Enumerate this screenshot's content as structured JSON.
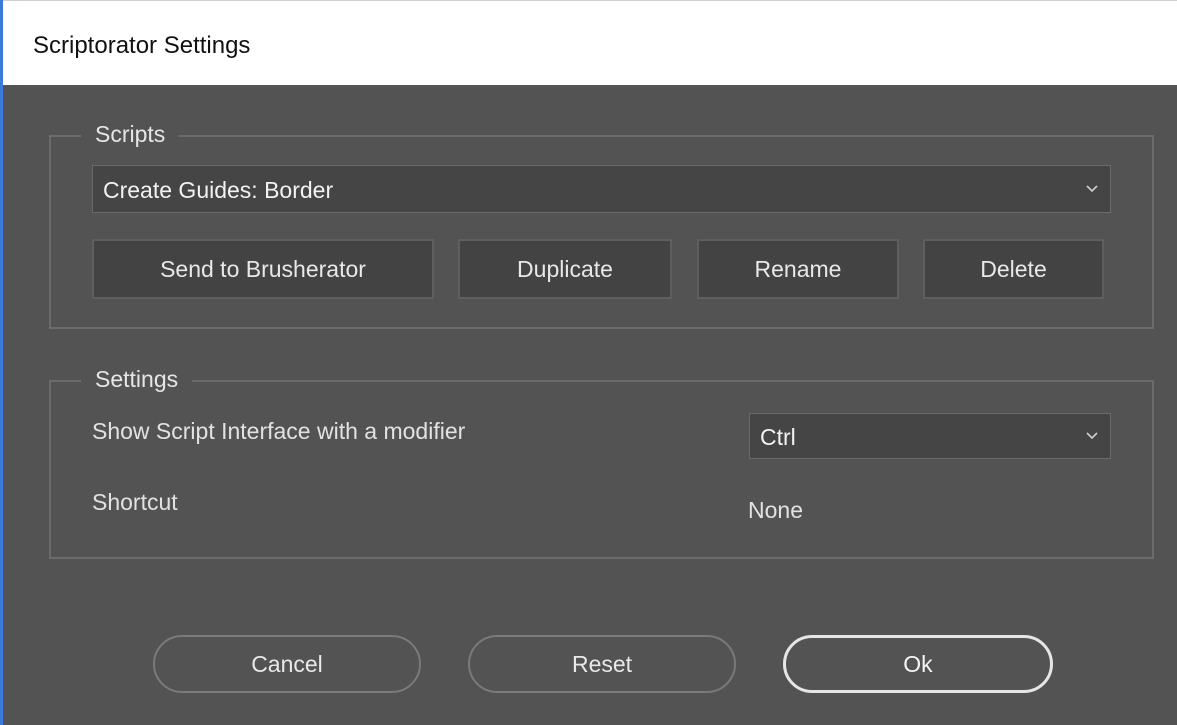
{
  "window": {
    "title": "Scriptorator Settings"
  },
  "scripts": {
    "legend": "Scripts",
    "selected_script": "Create Guides: Border",
    "buttons": {
      "send": "Send to Brusherator",
      "duplicate": "Duplicate",
      "rename": "Rename",
      "delete": "Delete"
    }
  },
  "settings": {
    "legend": "Settings",
    "modifier_label": "Show Script Interface with a modifier",
    "modifier_value": "Ctrl",
    "shortcut_label": "Shortcut",
    "shortcut_value": "None"
  },
  "footer": {
    "cancel": "Cancel",
    "reset": "Reset",
    "ok": "Ok"
  },
  "icons": {
    "dropdown": "chevron-down-icon"
  },
  "colors": {
    "background": "#535353",
    "titlebar": "#ffffff",
    "accent_border": "#3b7ad9"
  }
}
